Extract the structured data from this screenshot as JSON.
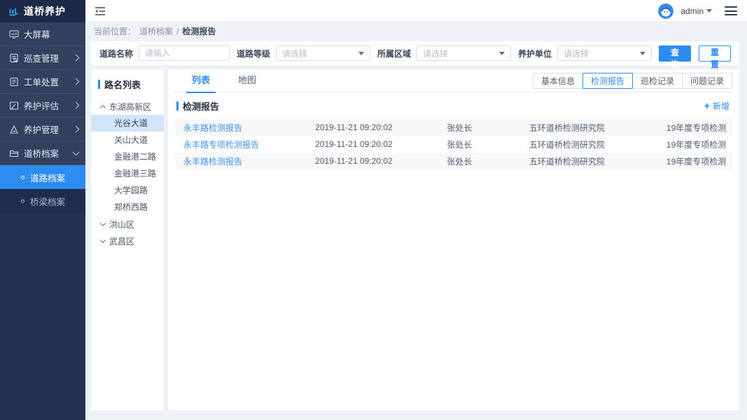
{
  "app": {
    "logo_text": "道桥养护"
  },
  "header": {
    "username": "admin"
  },
  "breadcrumb": {
    "prefix": "当前位置：",
    "parent": "道桥档案",
    "separator": "/",
    "current": "检测报告"
  },
  "sidebar": {
    "items": [
      {
        "label": "大屏幕",
        "icon": "screen-icon"
      },
      {
        "label": "巡查管理",
        "icon": "inspection-icon"
      },
      {
        "label": "工单处置",
        "icon": "work-order-icon"
      },
      {
        "label": "养护评估",
        "icon": "evaluation-icon"
      },
      {
        "label": "养护管理",
        "icon": "maintenance-icon"
      },
      {
        "label": "道桥档案",
        "icon": "archive-icon"
      }
    ],
    "submenu": [
      {
        "label": "道路档案",
        "active": true
      },
      {
        "label": "桥梁档案",
        "active": false
      }
    ]
  },
  "filters": {
    "fields": [
      {
        "label": "道路名称",
        "placeholder": "请输入",
        "type": "input"
      },
      {
        "label": "道路等级",
        "placeholder": "请选择",
        "type": "select"
      },
      {
        "label": "所属区域",
        "placeholder": "请选择",
        "type": "select"
      },
      {
        "label": "养护单位",
        "placeholder": "请选择",
        "type": "select"
      }
    ],
    "search_label": "查询",
    "reset_label": "重置"
  },
  "tree": {
    "title": "路名列表",
    "group1": {
      "label": "东湖高新区",
      "expanded": true
    },
    "group1_children": [
      "光谷大道",
      "关山大道",
      "金融港二路",
      "金融港三路",
      "大学园路",
      "郑桥西路"
    ],
    "group1_selected": "光谷大道",
    "group2": {
      "label": "洪山区",
      "expanded": false
    },
    "group3": {
      "label": "武昌区",
      "expanded": false
    }
  },
  "main": {
    "tabs": [
      {
        "label": "列表",
        "active": true
      },
      {
        "label": "地图",
        "active": false
      }
    ],
    "view_buttons": [
      {
        "label": "基本信息",
        "active": false
      },
      {
        "label": "检测报告",
        "active": true
      },
      {
        "label": "巡检记录",
        "active": false
      },
      {
        "label": "问题记录",
        "active": false
      }
    ],
    "section_title": "检测报告",
    "add_plus": "+",
    "add_label": "新增",
    "table": {
      "rows": [
        [
          "永丰路检测报告",
          "2019-11-21 09:20:02",
          "张处长",
          "五环道桥检测研究院",
          "19年度专项检测"
        ],
        [
          "永丰路专项检测报告",
          "2019-11-21 09:20:02",
          "张处长",
          "五环道桥检测研究院",
          "19年度专项检测"
        ],
        [
          "永丰路检测报告",
          "2019-11-21 09:20:02",
          "张处长",
          "五环道桥检测研究院",
          "19年度专项检测"
        ]
      ]
    }
  },
  "colors": {
    "primary": "#2d8cf0",
    "sidebar_background": "#243256",
    "sidebar_selected": "#2d8cf0",
    "content_background": "#eef1f6",
    "tree_selected_background": "#d2e6fb",
    "link_blue": "#3f94f2"
  }
}
